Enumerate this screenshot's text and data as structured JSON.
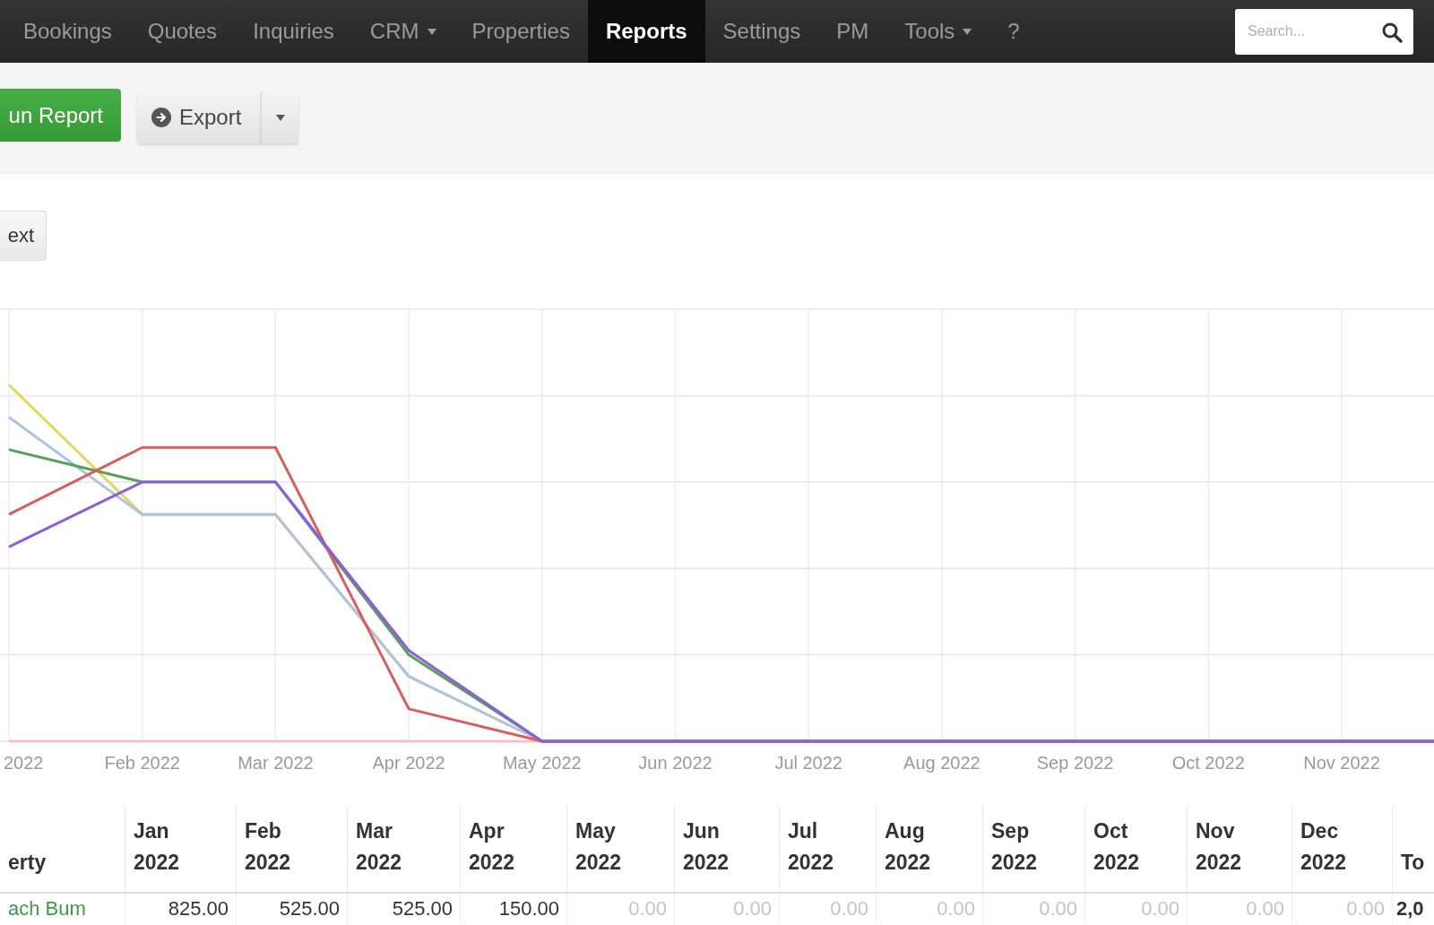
{
  "nav": {
    "items": [
      {
        "label": "Bookings",
        "selected": false,
        "dropdown": false
      },
      {
        "label": "Quotes",
        "selected": false,
        "dropdown": false
      },
      {
        "label": "Inquiries",
        "selected": false,
        "dropdown": false
      },
      {
        "label": "CRM",
        "selected": false,
        "dropdown": true
      },
      {
        "label": "Properties",
        "selected": false,
        "dropdown": false
      },
      {
        "label": "Reports",
        "selected": true,
        "dropdown": false
      },
      {
        "label": "Settings",
        "selected": false,
        "dropdown": false
      },
      {
        "label": "PM",
        "selected": false,
        "dropdown": false
      },
      {
        "label": "Tools",
        "selected": false,
        "dropdown": true
      },
      {
        "label": "?",
        "selected": false,
        "dropdown": false
      }
    ],
    "search": {
      "placeholder": "Search..."
    }
  },
  "toolbar": {
    "run_button": "un Report",
    "export_button": "Export"
  },
  "report": {
    "button": "ext"
  },
  "chart": {
    "x_labels": [
      "2022",
      "Feb 2022",
      "Mar 2022",
      "Apr 2022",
      "May 2022",
      "Jun 2022",
      "Jul 2022",
      "Aug 2022",
      "Sep 2022",
      "Oct 2022",
      "Nov 2022"
    ]
  },
  "table": {
    "columns": [
      "erty",
      "Jan 2022",
      "Feb 2022",
      "Mar 2022",
      "Apr 2022",
      "May 2022",
      "Jun 2022",
      "Jul 2022",
      "Aug 2022",
      "Sep 2022",
      "Oct 2022",
      "Nov 2022",
      "Dec 2022",
      "To"
    ],
    "rows": [
      {
        "cells": [
          {
            "text": "ach Bum",
            "kind": "link",
            "muted": false
          },
          {
            "text": "825.00",
            "kind": "number",
            "muted": false
          },
          {
            "text": "525.00",
            "kind": "number",
            "muted": false
          },
          {
            "text": "525.00",
            "kind": "number",
            "muted": false
          },
          {
            "text": "150.00",
            "kind": "number",
            "muted": false
          },
          {
            "text": "0.00",
            "kind": "number",
            "muted": true
          },
          {
            "text": "0.00",
            "kind": "number",
            "muted": true
          },
          {
            "text": "0.00",
            "kind": "number",
            "muted": true
          },
          {
            "text": "0.00",
            "kind": "number",
            "muted": true
          },
          {
            "text": "0.00",
            "kind": "number",
            "muted": true
          },
          {
            "text": "0.00",
            "kind": "number",
            "muted": true
          },
          {
            "text": "0.00",
            "kind": "number",
            "muted": true
          },
          {
            "text": "0.00",
            "kind": "number",
            "muted": true
          },
          {
            "text": "2,0",
            "kind": "total",
            "muted": false
          }
        ]
      }
    ]
  }
}
